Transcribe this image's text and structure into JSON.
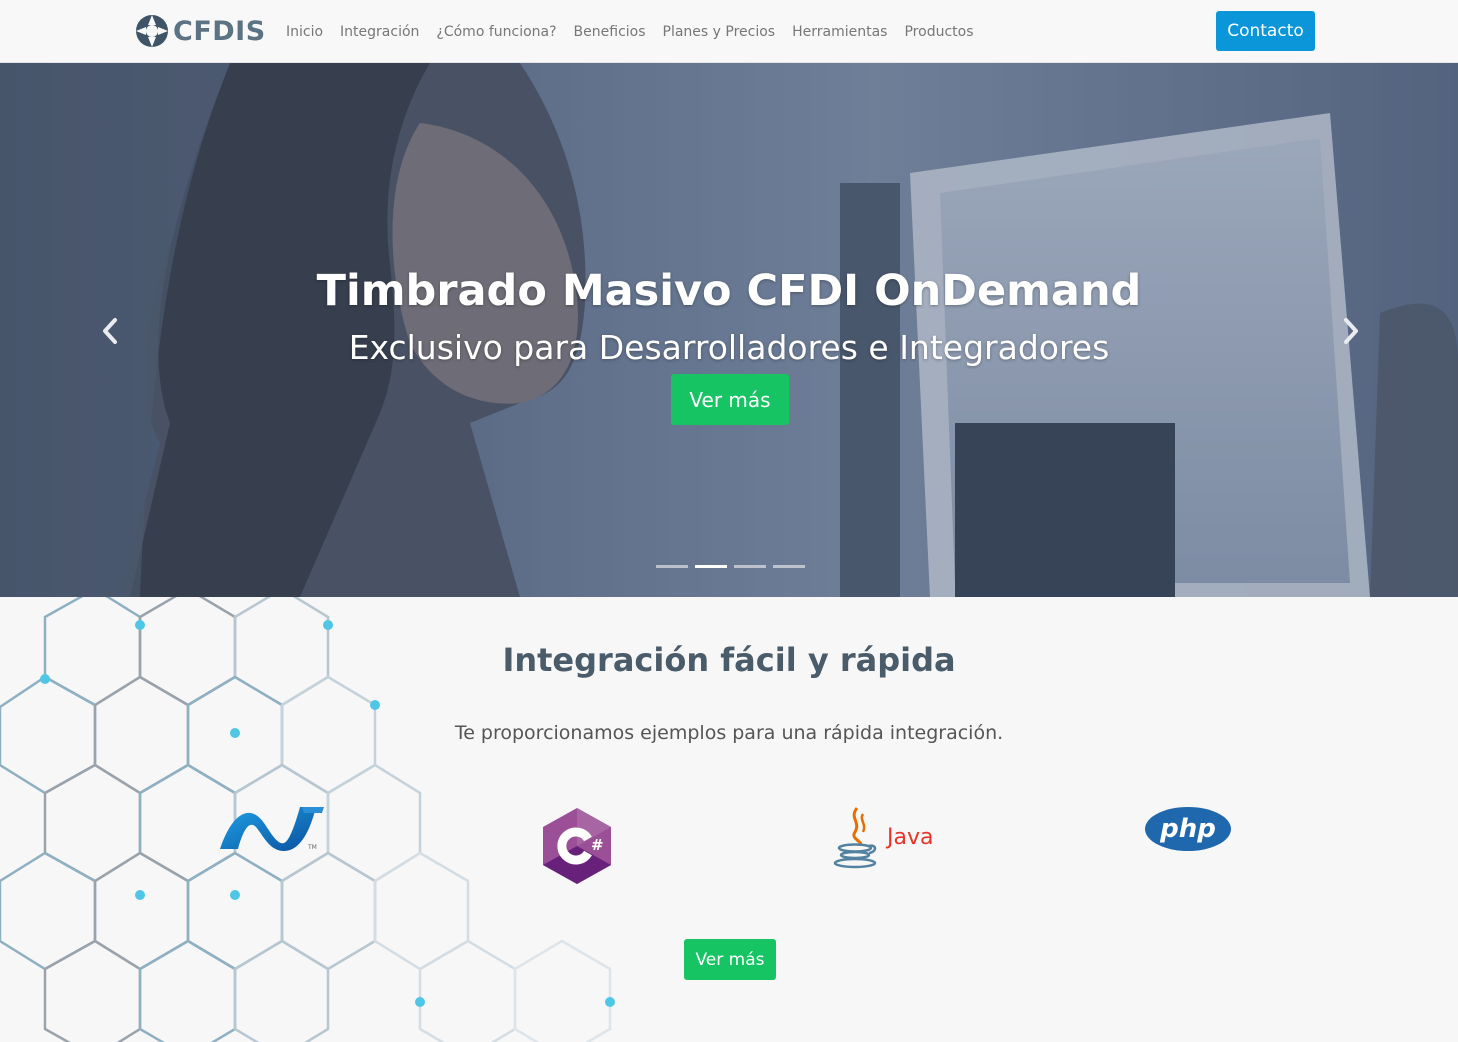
{
  "brand": {
    "name": "CFDIS",
    "color": "#5b7383",
    "icon": "cfdis-logo-icon"
  },
  "nav": {
    "items": [
      {
        "label": "Inicio"
      },
      {
        "label": "Integración"
      },
      {
        "label": "¿Cómo funciona?"
      },
      {
        "label": "Beneficios"
      },
      {
        "label": "Planes y Precios"
      },
      {
        "label": "Herramientas"
      },
      {
        "label": "Productos"
      }
    ],
    "contact_label": "Contacto",
    "contact_color": "#0b96d9"
  },
  "hero": {
    "title": "Timbrado Masivo CFDI OnDemand",
    "subtitle": "Exclusivo para Desarrolladores e Integradores",
    "button_label": "Ver más",
    "button_color": "#17c463",
    "prev_icon": "chevron-left-icon",
    "next_icon": "chevron-right-icon",
    "slides": 4,
    "active_slide": 2
  },
  "integration": {
    "title": "Integración fácil y rápida",
    "subtitle": "Te proporcionamos ejemplos para una rápida integración.",
    "languages": [
      {
        "name": ".NET",
        "icon": "dotnet-logo-icon"
      },
      {
        "name": "C#",
        "icon": "csharp-logo-icon"
      },
      {
        "name": "Java",
        "icon": "java-logo-icon"
      },
      {
        "name": "php",
        "icon": "php-logo-icon"
      }
    ],
    "button_label": "Ver más"
  }
}
